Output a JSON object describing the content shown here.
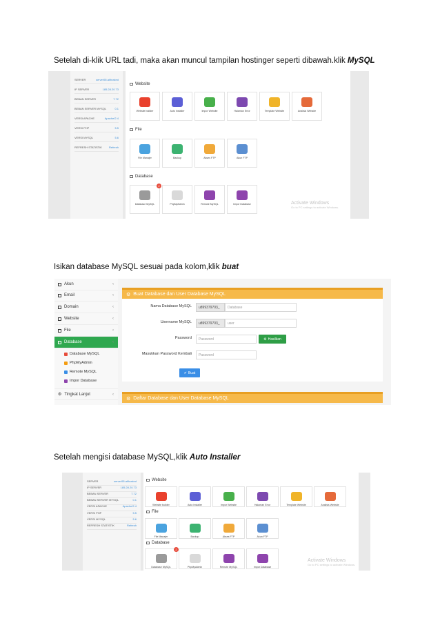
{
  "captions": {
    "c1_text": "Setelah di-klik URL tadi, maka akan muncul tampilan hostinger seperti dibawah.klik ",
    "c1_bold": "MySQL",
    "c2_text": "Isikan database MySQL sesuai pada kolom,klik ",
    "c2_bold": "buat",
    "c3_text": "Setelah mengisi database MySQL,klik ",
    "c3_bold": "Auto Installer"
  },
  "stats": [
    {
      "label": "SERVER",
      "value": "server55.althosted"
    },
    {
      "label": "IP SERVER",
      "value": "185.28.20.73"
    },
    {
      "label": "BEBAN SERVER",
      "value": "7.72"
    },
    {
      "label": "BEBAN SERVER MYSQL",
      "value": "0.1"
    },
    {
      "label": "VERSI APACHE",
      "value": "Apache/2.4"
    },
    {
      "label": "VERSI PHP",
      "value": "5.5"
    },
    {
      "label": "VERSI MYSQL",
      "value": "5.6"
    },
    {
      "label": "REFRESH STATISTIK",
      "value": "Refresh"
    }
  ],
  "sections": {
    "website": "Website",
    "file": "File",
    "database": "Database"
  },
  "website_tiles": [
    "Website builder",
    "Auto Installer",
    "Impor Website",
    "Halaman Error",
    "Template Website",
    "Analisis Website"
  ],
  "file_tiles": [
    "File Manajer",
    "Backup",
    "Akses FTP",
    "Akun FTP"
  ],
  "database_tiles": [
    "Database MySQL",
    "PhpMyAdmin",
    "Remote MySQL",
    "Impor Database"
  ],
  "database_badge": "2",
  "watermark": {
    "title": "Activate Windows",
    "sub": "Go to PC settings to activate Windows."
  },
  "menu": {
    "items": [
      "Akun",
      "Email",
      "Domain",
      "Website",
      "File",
      "Database"
    ],
    "subitems": [
      "Database MySQL",
      "PhpMyAdmin",
      "Remote MySQL",
      "Impor Database"
    ],
    "after": "Tingkat Lanjut"
  },
  "form": {
    "header": "Buat Database dan User Database MySQL",
    "name_label": "Nama Database MySQL",
    "name_prefix": "u899379703_",
    "name_placeholder": "Database",
    "user_label": "Username MySQL",
    "user_prefix": "u899379703_",
    "user_placeholder": "user",
    "pass_label": "Password",
    "pass_placeholder": "Password",
    "generate_label": "Hasilkan",
    "repass_label": "Masukkan Password Kembali",
    "repass_placeholder": "Password",
    "submit_label": "Buat",
    "list_header": "Daftar Database dan User Database MySQL"
  },
  "colors": {
    "accent_orange": "#f6b94a",
    "active_green": "#2fa84f",
    "button_blue": "#3a8ee6",
    "generate_green": "#2e9e46"
  }
}
